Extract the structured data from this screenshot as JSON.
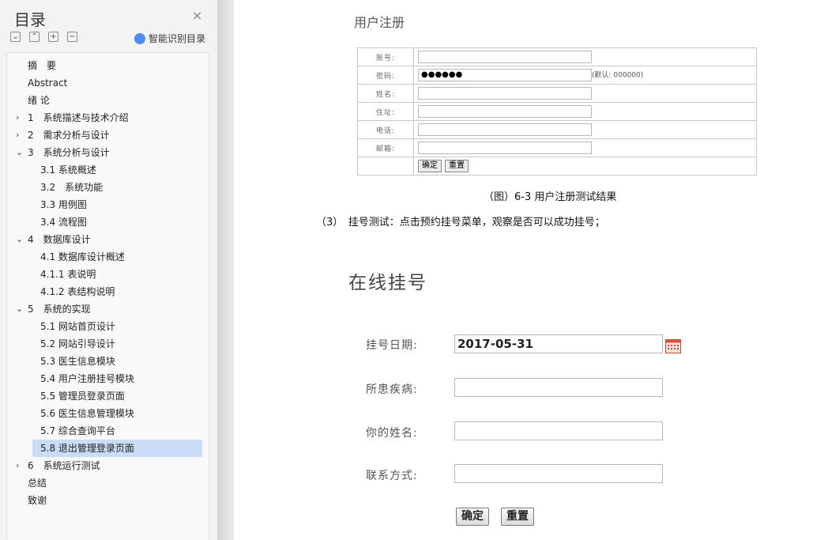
{
  "sidebar": {
    "title": "目录",
    "close_glyph": "×",
    "toolbar": {
      "collapse_all": "⌄",
      "expand_up": "⌃",
      "expand": "+",
      "collapse": "−",
      "ai_label": "智能识别目录"
    },
    "items": [
      {
        "label": "摘　要"
      },
      {
        "label": "Abstract"
      },
      {
        "label": "绪 论"
      },
      {
        "label": "1　系统描述与技术介绍",
        "arrow": "›"
      },
      {
        "label": "2　需求分析与设计",
        "arrow": "›"
      },
      {
        "label": "3　系统分析与设计",
        "arrow": "⌄"
      },
      {
        "label": "3.1 系统概述"
      },
      {
        "label": "3.2　系统功能"
      },
      {
        "label": "3.3 用例图"
      },
      {
        "label": "3.4 流程图"
      },
      {
        "label": "4　数据库设计",
        "arrow": "⌄"
      },
      {
        "label": "4.1 数据库设计概述"
      },
      {
        "label": "4.1.1 表说明"
      },
      {
        "label": "4.1.2 表结构说明"
      },
      {
        "label": "5　系统的实现",
        "arrow": "⌄"
      },
      {
        "label": "5.1 网站首页设计"
      },
      {
        "label": "5.2 网站引导设计"
      },
      {
        "label": "5.3 医生信息模块"
      },
      {
        "label": "5.4 用户注册挂号模块"
      },
      {
        "label": "5.5 管理员登录页面"
      },
      {
        "label": "5.6 医生信息管理模块"
      },
      {
        "label": "5.7 综合查询平台"
      },
      {
        "label": "5.8 退出管理登录页面"
      },
      {
        "label": "6　系统运行测试",
        "arrow": "›"
      },
      {
        "label": "总结"
      },
      {
        "label": "致谢"
      }
    ],
    "selected_index": 22
  },
  "document": {
    "reg_title": "用户注册",
    "reg_form": {
      "account_label": "账号:",
      "password_label": "密码:",
      "password_value": "●●●●●●",
      "password_hint": "(默认: 000000)",
      "name_label": "姓名:",
      "address_label": "住址:",
      "phone_label": "电话:",
      "email_label": "邮箱:",
      "ok": "确定",
      "reset": "重置"
    },
    "caption": "（图）6-3 用户注册测试结果",
    "paragraph": "（3）　挂号测试：点击预约挂号菜单，观察是否可以成功挂号；",
    "booking": {
      "title": "在线挂号",
      "date_label": "挂号日期:",
      "date_value": "2017-05-31",
      "disease_label": "所患疾病:",
      "name_label": "你的姓名:",
      "contact_label": "联系方式:",
      "ok": "确定",
      "reset": "重置"
    }
  },
  "colors": {
    "selected": "#cbdcf6",
    "ai_icon": "#4d8bf5"
  }
}
